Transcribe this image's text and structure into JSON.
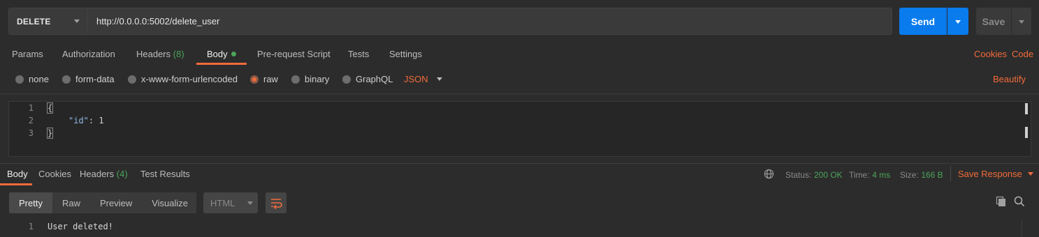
{
  "request": {
    "method": "DELETE",
    "url": "http://0.0.0.0:5002/delete_user",
    "send_label": "Send",
    "save_label": "Save"
  },
  "request_tabs": {
    "params": "Params",
    "authorization": "Authorization",
    "headers": "Headers",
    "headers_count": "(8)",
    "body": "Body",
    "prerequest": "Pre-request Script",
    "tests": "Tests",
    "settings": "Settings",
    "cookies": "Cookies",
    "code": "Code"
  },
  "body_types": {
    "none": "none",
    "form_data": "form-data",
    "urlencoded": "x-www-form-urlencoded",
    "raw": "raw",
    "binary": "binary",
    "graphql": "GraphQL",
    "format": "JSON",
    "beautify": "Beautify",
    "selected": "raw"
  },
  "editor": {
    "lines": [
      "1",
      "2",
      "3"
    ],
    "open_brace": "{",
    "key": "\"id\"",
    "colon": ": ",
    "value": "1",
    "close_brace": "}"
  },
  "response_tabs": {
    "body": "Body",
    "cookies": "Cookies",
    "headers": "Headers",
    "headers_count": "(4)",
    "test_results": "Test Results"
  },
  "response_meta": {
    "status_label": "Status:",
    "status_value": "200 OK",
    "time_label": "Time:",
    "time_value": "4 ms",
    "size_label": "Size:",
    "size_value": "166 B",
    "save_response": "Save Response"
  },
  "response_view": {
    "pretty": "Pretty",
    "raw": "Raw",
    "preview": "Preview",
    "visualize": "Visualize",
    "format": "HTML"
  },
  "response_body": {
    "line_number": "1",
    "text": "User deleted!"
  },
  "colors": {
    "accent": "#f26b3a",
    "send": "#097bed",
    "success": "#4ba55a"
  }
}
